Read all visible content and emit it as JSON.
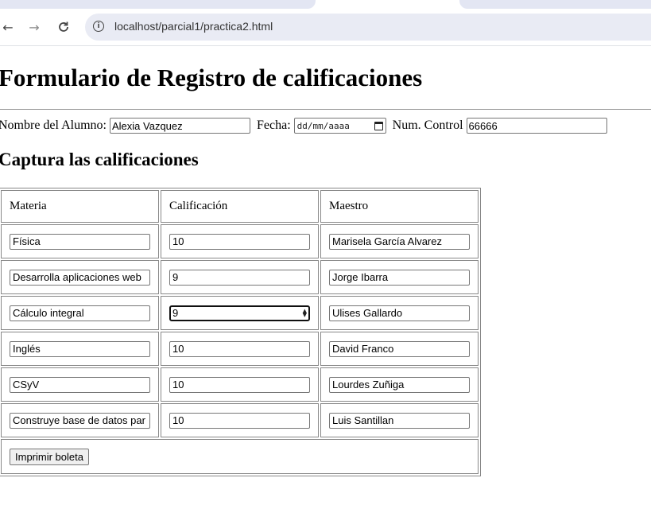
{
  "browser": {
    "url": "localhost/parcial1/practica2.html"
  },
  "page": {
    "title": "Formulario de Registro de calificaciones",
    "student_label": "Nombre del Alumno:",
    "student_value": "Alexia Vazquez",
    "date_label": "Fecha:",
    "date_placeholder": "dd/mm/aaaa",
    "control_label": "Num. Control",
    "control_value": "66666",
    "subtitle": "Captura las calificaciones",
    "table": {
      "headers": [
        "Materia",
        "Calificación",
        "Maestro"
      ],
      "rows": [
        {
          "materia": "Física",
          "calificacion": "10",
          "maestro": "Marisela García Alvarez"
        },
        {
          "materia": "Desarrolla aplicaciones web",
          "calificacion": "9",
          "maestro": "Jorge Ibarra"
        },
        {
          "materia": "Cálculo integral",
          "calificacion": "9",
          "maestro": "Ulises Gallardo"
        },
        {
          "materia": "Inglés",
          "calificacion": "10",
          "maestro": "David Franco"
        },
        {
          "materia": "CSyV",
          "calificacion": "10",
          "maestro": "Lourdes Zuñiga"
        },
        {
          "materia": "Construye base de datos par",
          "calificacion": "10",
          "maestro": "Luis Santillan"
        }
      ]
    },
    "print_button": "Imprimir boleta"
  }
}
